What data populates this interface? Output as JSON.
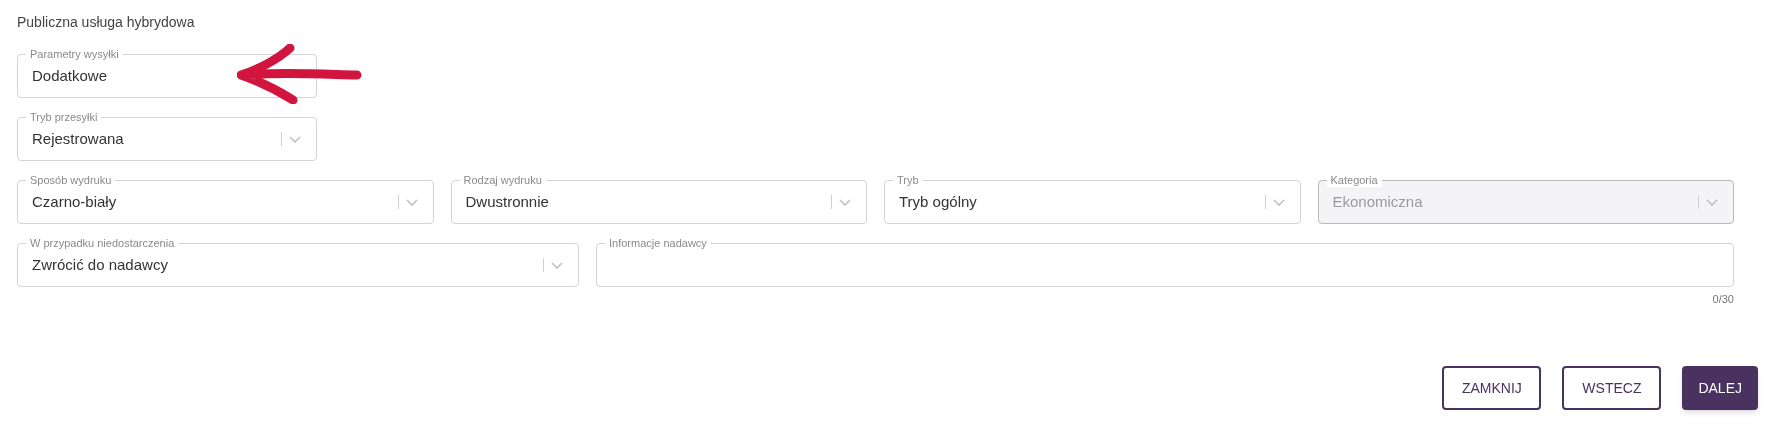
{
  "title": "Publiczna usługa hybrydowa",
  "rows": [
    [
      {
        "kind": "text",
        "label": "Parametry wysyłki",
        "value": "Dodatkowe",
        "disabled": false
      }
    ],
    [
      {
        "kind": "select",
        "label": "Tryb przesyłki",
        "value": "Rejestrowana",
        "disabled": false
      }
    ],
    [
      {
        "kind": "select",
        "label": "Sposób wydruku",
        "value": "Czarno-biały",
        "disabled": false
      },
      {
        "kind": "select",
        "label": "Rodzaj wydruku",
        "value": "Dwustronnie",
        "disabled": false
      },
      {
        "kind": "select",
        "label": "Tryb",
        "value": "Tryb ogólny",
        "disabled": false
      },
      {
        "kind": "select",
        "label": "Kategoria",
        "value": "Ekonomiczna",
        "disabled": true
      }
    ],
    [
      {
        "kind": "select",
        "label": "W przypadku niedostarczenia",
        "value": "Zwrócić do nadawcy",
        "disabled": false
      },
      {
        "kind": "text",
        "label": "Informacje nadawcy",
        "counter": "0/30",
        "disabled": false
      }
    ]
  ],
  "buttons": [
    {
      "label": "ZAMKNIJ",
      "kind": "outline"
    },
    {
      "label": "WSTECZ",
      "kind": "outline"
    },
    {
      "label": "DALEJ",
      "kind": "primary"
    }
  ]
}
